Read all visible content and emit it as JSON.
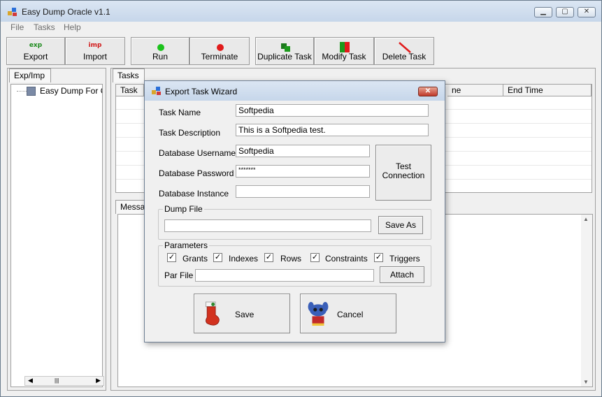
{
  "app": {
    "title": "Easy Dump Oracle v1.1"
  },
  "menu": {
    "items": [
      "File",
      "Tasks",
      "Help"
    ]
  },
  "toolbar": {
    "export_tag": "exp",
    "export_label": "Export",
    "import_tag": "imp",
    "import_label": "Import",
    "run_label": "Run",
    "terminate_label": "Terminate",
    "duplicate_label": "Duplicate Task",
    "modify_label": "Modify Task",
    "delete_label": "Delete Task"
  },
  "left_panel": {
    "tab": "Exp/Imp",
    "tree_item": "Easy Dump For Or..."
  },
  "right_panel": {
    "tab": "Tasks",
    "columns": [
      "Task",
      "ne",
      "End Time"
    ],
    "messages_label": "Messag"
  },
  "dialog": {
    "title": "Export Task Wizard",
    "task_name_label": "Task Name",
    "task_name_value": "Softpedia",
    "task_desc_label": "Task Description",
    "task_desc_value": "This is a Softpedia test.",
    "db_user_label": "Database Username",
    "db_user_value": "Softpedia",
    "db_pass_label": "Database Password",
    "db_pass_value": "*******",
    "db_instance_label": "Database Instance",
    "db_instance_value": "",
    "test_connection_label": "Test\nConnection",
    "dump_file_group": "Dump File",
    "dump_file_value": "",
    "save_as_label": "Save As",
    "params_group": "Parameters",
    "params": [
      {
        "label": "Grants",
        "checked": true
      },
      {
        "label": "Indexes",
        "checked": true
      },
      {
        "label": "Rows",
        "checked": true
      },
      {
        "label": "Constraints",
        "checked": true
      },
      {
        "label": "Triggers",
        "checked": true
      }
    ],
    "par_file_label": "Par File",
    "par_file_value": "",
    "attach_label": "Attach",
    "save_label": "Save",
    "cancel_label": "Cancel"
  },
  "colors": {
    "accent_green": "#1c9a1c",
    "accent_red": "#e11b1b",
    "title_bg": "#c6d6ea"
  }
}
